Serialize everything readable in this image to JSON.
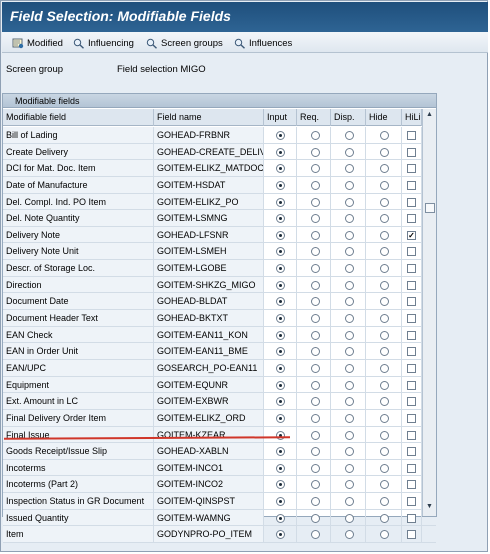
{
  "window": {
    "title": "Field Selection: Modifiable Fields"
  },
  "toolbar": {
    "modified": "Modified",
    "influencing": "Influencing",
    "screen_groups": "Screen groups",
    "influences": "Influences"
  },
  "screen_group": {
    "label": "Screen group",
    "value": "Field selection MIGO"
  },
  "table": {
    "title": "Modifiable fields",
    "columns": [
      "Modifiable field",
      "Field name",
      "Input",
      "Req.",
      "Disp.",
      "Hide",
      "HiLi"
    ],
    "rows": [
      {
        "field": "Bill of Lading",
        "name": "GOHEAD-FRBNR",
        "sel": "input",
        "hili": false
      },
      {
        "field": "Create Delivery",
        "name": "GOHEAD-CREATE_DELIV...",
        "sel": "input",
        "hili": false
      },
      {
        "field": "DCI for Mat. Doc. Item",
        "name": "GOITEM-ELIKZ_MATDOC",
        "sel": "input",
        "hili": false
      },
      {
        "field": "Date of Manufacture",
        "name": "GOITEM-HSDAT",
        "sel": "input",
        "hili": false
      },
      {
        "field": "Del. Compl. Ind. PO Item",
        "name": "GOITEM-ELIKZ_PO",
        "sel": "input",
        "hili": false
      },
      {
        "field": "Del. Note Quantity",
        "name": "GOITEM-LSMNG",
        "sel": "input",
        "hili": false
      },
      {
        "field": "Delivery Note",
        "name": "GOHEAD-LFSNR",
        "sel": "input",
        "hili": true
      },
      {
        "field": "Delivery Note Unit",
        "name": "GOITEM-LSMEH",
        "sel": "input",
        "hili": false
      },
      {
        "field": "Descr. of Storage Loc.",
        "name": "GOITEM-LGOBE",
        "sel": "input",
        "hili": false
      },
      {
        "field": "Direction",
        "name": "GOITEM-SHKZG_MIGO",
        "sel": "input",
        "hili": false
      },
      {
        "field": "Document Date",
        "name": "GOHEAD-BLDAT",
        "sel": "input",
        "hili": false
      },
      {
        "field": "Document Header Text",
        "name": "GOHEAD-BKTXT",
        "sel": "input",
        "hili": false
      },
      {
        "field": "EAN Check",
        "name": "GOITEM-EAN11_KON",
        "sel": "input",
        "hili": false
      },
      {
        "field": "EAN in Order Unit",
        "name": "GOITEM-EAN11_BME",
        "sel": "input",
        "hili": false
      },
      {
        "field": "EAN/UPC",
        "name": "GOSEARCH_PO-EAN11",
        "sel": "input",
        "hili": false
      },
      {
        "field": "Equipment",
        "name": "GOITEM-EQUNR",
        "sel": "input",
        "hili": false
      },
      {
        "field": "Ext. Amount in LC",
        "name": "GOITEM-EXBWR",
        "sel": "input",
        "hili": false
      },
      {
        "field": "Final Delivery Order Item",
        "name": "GOITEM-ELIKZ_ORD",
        "sel": "input",
        "hili": false
      },
      {
        "field": "Final Issue",
        "name": "GOITEM-KZEAR",
        "sel": "input",
        "hili": false
      },
      {
        "field": "Goods Receipt/Issue Slip",
        "name": "GOHEAD-XABLN",
        "sel": "input",
        "hili": false
      },
      {
        "field": "Incoterms",
        "name": "GOITEM-INCO1",
        "sel": "input",
        "hili": false
      },
      {
        "field": "Incoterms (Part 2)",
        "name": "GOITEM-INCO2",
        "sel": "input",
        "hili": false
      },
      {
        "field": "Inspection Status in GR Document",
        "name": "GOITEM-QINSPST",
        "sel": "input",
        "hili": false
      },
      {
        "field": "Issued Quantity",
        "name": "GOITEM-WAMNG",
        "sel": "input",
        "hili": false
      },
      {
        "field": "Item",
        "name": "GODYNPRO-PO_ITEM",
        "sel": "input",
        "hili": false
      }
    ]
  },
  "colors": {
    "title_bar": "#1f4f7c",
    "highlight_line": "#d0362a"
  },
  "icons": [
    "modified-icon",
    "influencing-icon",
    "screen-groups-icon",
    "influences-icon"
  ]
}
